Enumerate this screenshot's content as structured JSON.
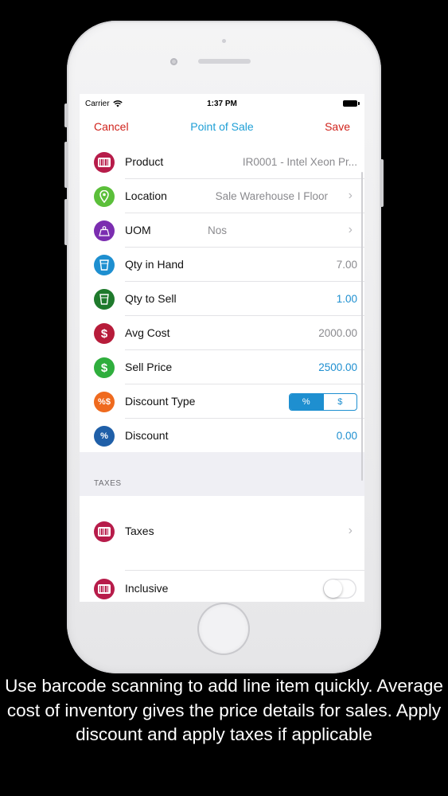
{
  "statusbar": {
    "carrier": "Carrier",
    "time": "1:37 PM"
  },
  "navbar": {
    "cancel": "Cancel",
    "title": "Point of Sale",
    "save": "Save"
  },
  "rows": [
    {
      "label": "Product",
      "value": "IR0001 - Intel Xeon Pr...",
      "icon": "barcode-icon",
      "color": "#b71c4a"
    },
    {
      "label": "Location",
      "value": "Sale Warehouse I Floor",
      "icon": "location-pin-icon",
      "color": "#5bbf3a"
    },
    {
      "label": "UOM",
      "value": "Nos",
      "icon": "weight-icon",
      "color": "#7b2db0"
    },
    {
      "label": "Qty in Hand",
      "value": "7.00",
      "icon": "cup-icon",
      "color": "#1e8fd0"
    },
    {
      "label": "Qty to Sell",
      "value": "1.00",
      "icon": "cup-icon",
      "color": "#1f7a2c"
    },
    {
      "label": "Avg Cost",
      "value": "2000.00",
      "icon": "dollar-icon",
      "color": "#b71c3a"
    },
    {
      "label": "Sell Price",
      "value": "2500.00",
      "icon": "dollar-icon",
      "color": "#2fae3d"
    },
    {
      "label": "Discount Type",
      "icon": "percent-dollar-icon",
      "color": "#ef6a1e",
      "options": [
        "%",
        "$"
      ],
      "selected": "%"
    },
    {
      "label": "Discount",
      "value": "0.00",
      "icon": "percent-icon",
      "color": "#1f5fa8"
    }
  ],
  "taxes_section": {
    "header": "TAXES",
    "taxes_label": "Taxes",
    "inclusive_label": "Inclusive",
    "inclusive_on": false
  },
  "caption": "Use barcode scanning to add line item quickly. Average cost of inventory gives the price details for sales. Apply discount and apply taxes if applicable",
  "colors": {
    "accent_red": "#d0231c",
    "accent_blue": "#1e9fd6"
  }
}
